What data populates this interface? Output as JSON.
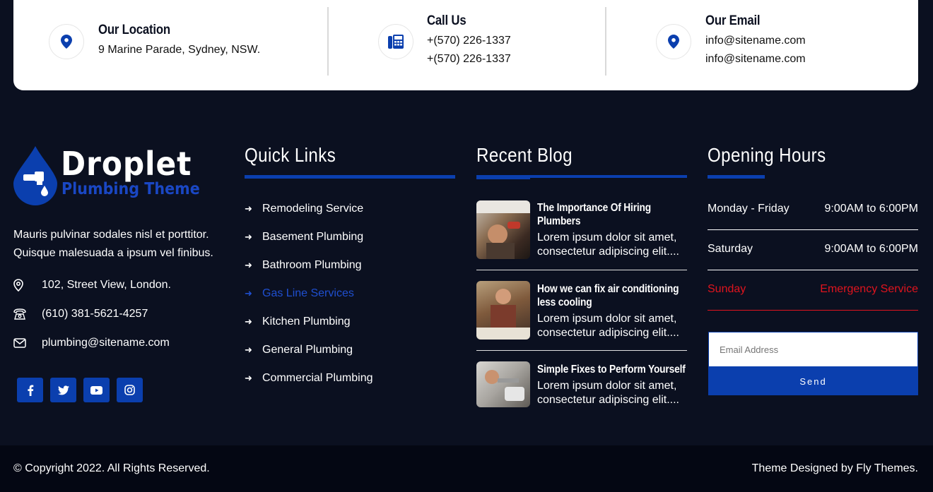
{
  "contact": {
    "location": {
      "title": "Our Location",
      "line1": "9 Marine Parade, Sydney, NSW."
    },
    "call": {
      "title": "Call Us",
      "line1": "+(570) 226-1337",
      "line2": "+(570) 226-1337"
    },
    "email": {
      "title": "Our Email",
      "line1": "info@sitename.com",
      "line2": "info@sitename.com"
    }
  },
  "brand": {
    "name": "Droplet",
    "tagline": "Plumbing Theme"
  },
  "about": {
    "text": "Mauris pulvinar sodales nisl et porttitor. Quisque malesuada a ipsum vel finibus.",
    "address": "102, Street View, London.",
    "phone": "(610) 381-5621-4257",
    "email": "plumbing@sitename.com"
  },
  "social": [
    "facebook-icon",
    "twitter-icon",
    "youtube-icon",
    "instagram-icon"
  ],
  "quick_links": {
    "heading": "Quick Links",
    "items": [
      {
        "label": "Remodeling Service"
      },
      {
        "label": "Basement Plumbing"
      },
      {
        "label": "Bathroom Plumbing"
      },
      {
        "label": "Gas Line Services"
      },
      {
        "label": "Kitchen Plumbing"
      },
      {
        "label": "General Plumbing"
      },
      {
        "label": "Commercial Plumbing"
      }
    ]
  },
  "blog": {
    "heading": "Recent Blog",
    "posts": [
      {
        "title": "The Importance Of Hiring Plumbers",
        "excerpt": "Lorem ipsum dolor sit amet, consectetur adipiscing elit...."
      },
      {
        "title": "How we can fix air conditioning less cooling",
        "excerpt": "Lorem ipsum dolor sit amet, consectetur adipiscing elit...."
      },
      {
        "title": "Simple Fixes to Perform Yourself",
        "excerpt": "Lorem ipsum dolor sit amet, consectetur adipiscing elit...."
      }
    ]
  },
  "hours": {
    "heading": "Opening Hours",
    "rows": [
      {
        "day": "Monday - Friday",
        "time": "9:00AM to 6:00PM"
      },
      {
        "day": "Saturday",
        "time": "9:00AM to 6:00PM"
      },
      {
        "day": "Sunday",
        "time": "Emergency Service"
      }
    ],
    "email_placeholder": "Email Address",
    "send_label": "Send"
  },
  "footer": {
    "copyright": "© Copyright 2022. All Rights Reserved.",
    "credit": "Theme Designed by Fly Themes."
  },
  "colors": {
    "accent": "#0b3fae",
    "background": "#0b1020",
    "alert": "#e0141e"
  }
}
